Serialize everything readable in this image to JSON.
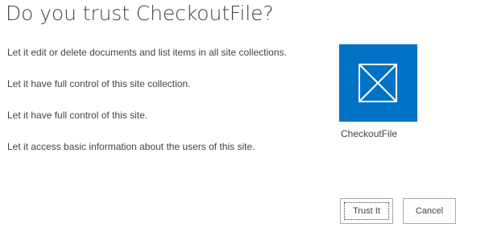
{
  "dialog": {
    "title": "Do you trust CheckoutFile?",
    "permissions": [
      "Let it edit or delete documents and list items in all site collections.",
      "Let it have full control of this site collection.",
      "Let it have full control of this site.",
      "Let it access basic information about the users of this site."
    ],
    "app": {
      "name": "CheckoutFile",
      "icon": "placeholder-image-icon",
      "tile_color": "#0072c6"
    },
    "buttons": {
      "trust_label": "Trust It",
      "cancel_label": "Cancel"
    }
  }
}
